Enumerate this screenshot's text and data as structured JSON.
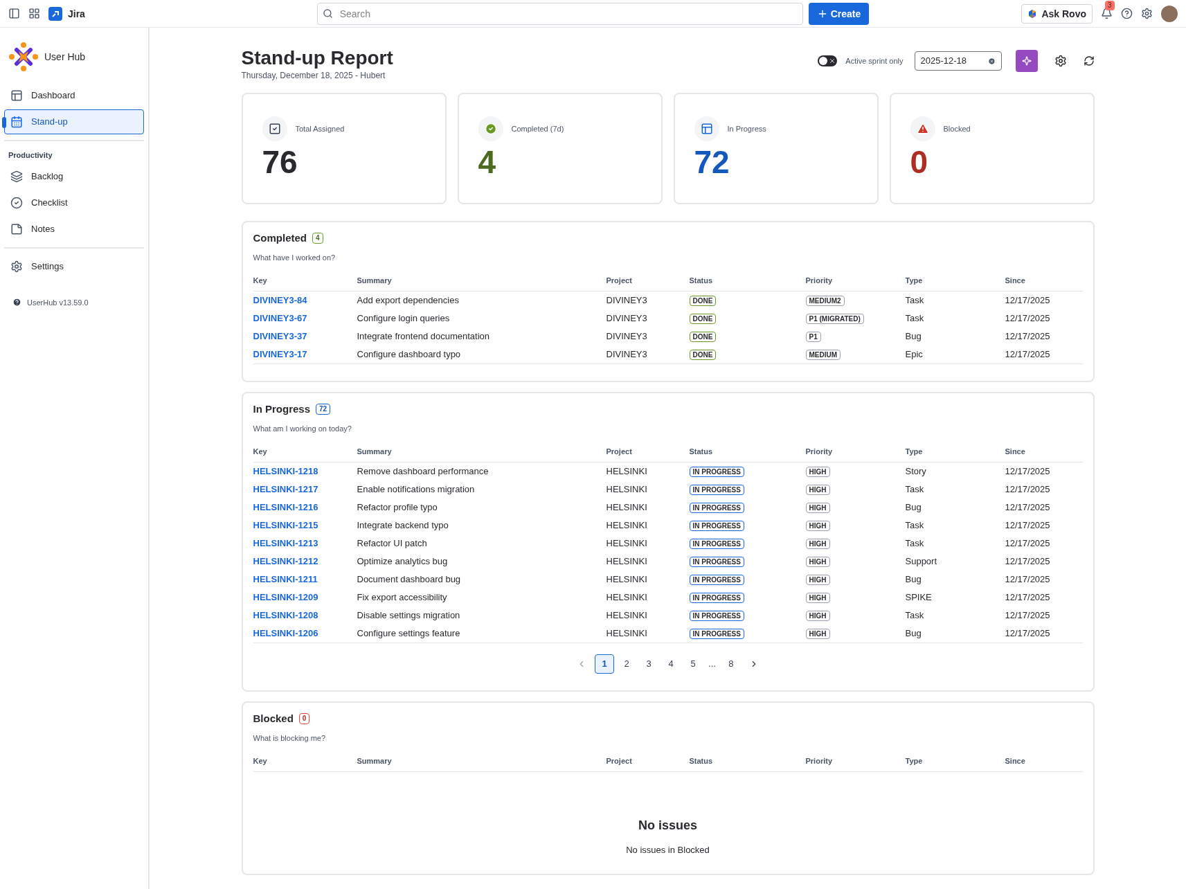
{
  "topbar": {
    "app": "Jira",
    "search_placeholder": "Search",
    "create": "Create",
    "ask": "Ask Rovo",
    "notifications": "3"
  },
  "sidebar": {
    "brand": "User Hub",
    "sections": [
      {
        "items": [
          {
            "kind": "dashboard",
            "label": "Dashboard",
            "selected": false
          },
          {
            "kind": "standup",
            "label": "Stand-up",
            "selected": true
          }
        ]
      },
      {
        "heading": "Productivity",
        "items": [
          {
            "kind": "backlog",
            "label": "Backlog",
            "selected": false
          },
          {
            "kind": "checklist",
            "label": "Checklist",
            "selected": false
          },
          {
            "kind": "notes",
            "label": "Notes",
            "selected": false
          }
        ]
      },
      {
        "items": [
          {
            "kind": "settings",
            "label": "Settings",
            "selected": false
          }
        ]
      }
    ],
    "version": "UserHub v13.59.0"
  },
  "header": {
    "title": "Stand-up Report",
    "subtitle": "Thursday, December 18, 2025 - Hubert",
    "toggle": {
      "label": "Active sprint only",
      "on": false
    },
    "date": "2025-12-18"
  },
  "cards": [
    {
      "kind": "total",
      "label": "Total Assigned",
      "value": "76"
    },
    {
      "kind": "completed",
      "label": "Completed (7d)",
      "value": "4"
    },
    {
      "kind": "progress",
      "label": "In Progress",
      "value": "72"
    },
    {
      "kind": "blocked",
      "label": "Blocked",
      "value": "0"
    }
  ],
  "sections": [
    {
      "kind": "completed",
      "title": "Completed",
      "count": "4",
      "subtitle": "What have I worked on?",
      "columns": [
        "Key",
        "Summary",
        "Project",
        "Status",
        "Priority",
        "Type",
        "Since"
      ],
      "rows": [
        {
          "key": "DIVINEY3-84",
          "summary": "Add export dependencies",
          "project": "DIVINEY3",
          "status": "DONE",
          "priority": "MEDIUM2",
          "type": "Task",
          "since": "12/17/2025"
        },
        {
          "key": "DIVINEY3-67",
          "summary": "Configure login queries",
          "project": "DIVINEY3",
          "status": "DONE",
          "priority": "P1 (MIGRATED)",
          "type": "Task",
          "since": "12/17/2025"
        },
        {
          "key": "DIVINEY3-37",
          "summary": "Integrate frontend documentation",
          "project": "DIVINEY3",
          "status": "DONE",
          "priority": "P1",
          "type": "Bug",
          "since": "12/17/2025"
        },
        {
          "key": "DIVINEY3-17",
          "summary": "Configure dashboard typo",
          "project": "DIVINEY3",
          "status": "DONE",
          "priority": "MEDIUM",
          "type": "Epic",
          "since": "12/17/2025"
        }
      ]
    },
    {
      "kind": "progress",
      "title": "In Progress",
      "count": "72",
      "subtitle": "What am I working on today?",
      "columns": [
        "Key",
        "Summary",
        "Project",
        "Status",
        "Priority",
        "Type",
        "Since"
      ],
      "rows": [
        {
          "key": "HELSINKI-1218",
          "summary": "Remove dashboard performance",
          "project": "HELSINKI",
          "status": "IN PROGRESS",
          "priority": "HIGH",
          "type": "Story",
          "since": "12/17/2025"
        },
        {
          "key": "HELSINKI-1217",
          "summary": "Enable notifications migration",
          "project": "HELSINKI",
          "status": "IN PROGRESS",
          "priority": "HIGH",
          "type": "Task",
          "since": "12/17/2025"
        },
        {
          "key": "HELSINKI-1216",
          "summary": "Refactor profile typo",
          "project": "HELSINKI",
          "status": "IN PROGRESS",
          "priority": "HIGH",
          "type": "Bug",
          "since": "12/17/2025"
        },
        {
          "key": "HELSINKI-1215",
          "summary": "Integrate backend typo",
          "project": "HELSINKI",
          "status": "IN PROGRESS",
          "priority": "HIGH",
          "type": "Task",
          "since": "12/17/2025"
        },
        {
          "key": "HELSINKI-1213",
          "summary": "Refactor UI patch",
          "project": "HELSINKI",
          "status": "IN PROGRESS",
          "priority": "HIGH",
          "type": "Task",
          "since": "12/17/2025"
        },
        {
          "key": "HELSINKI-1212",
          "summary": "Optimize analytics bug",
          "project": "HELSINKI",
          "status": "IN PROGRESS",
          "priority": "HIGH",
          "type": "Support",
          "since": "12/17/2025"
        },
        {
          "key": "HELSINKI-1211",
          "summary": "Document dashboard bug",
          "project": "HELSINKI",
          "status": "IN PROGRESS",
          "priority": "HIGH",
          "type": "Bug",
          "since": "12/17/2025"
        },
        {
          "key": "HELSINKI-1209",
          "summary": "Fix export accessibility",
          "project": "HELSINKI",
          "status": "IN PROGRESS",
          "priority": "HIGH",
          "type": "SPIKE",
          "since": "12/17/2025"
        },
        {
          "key": "HELSINKI-1208",
          "summary": "Disable settings migration",
          "project": "HELSINKI",
          "status": "IN PROGRESS",
          "priority": "HIGH",
          "type": "Task",
          "since": "12/17/2025"
        },
        {
          "key": "HELSINKI-1206",
          "summary": "Configure settings feature",
          "project": "HELSINKI",
          "status": "IN PROGRESS",
          "priority": "HIGH",
          "type": "Bug",
          "since": "12/17/2025"
        }
      ],
      "pagination": [
        {
          "kind": "page",
          "label": "1",
          "selected": true
        },
        {
          "kind": "page",
          "label": "2",
          "selected": false
        },
        {
          "kind": "page",
          "label": "3",
          "selected": false
        },
        {
          "kind": "page",
          "label": "4",
          "selected": false
        },
        {
          "kind": "page",
          "label": "5",
          "selected": false
        },
        {
          "kind": "gap",
          "label": "..."
        },
        {
          "kind": "page",
          "label": "8",
          "selected": false
        }
      ]
    },
    {
      "kind": "blocked",
      "title": "Blocked",
      "count": "0",
      "subtitle": "What is blocking me?",
      "columns": [
        "Key",
        "Summary",
        "Project",
        "Status",
        "Priority",
        "Type",
        "Since"
      ],
      "empty": {
        "title": "No issues",
        "text": "No issues in Blocked"
      }
    }
  ]
}
